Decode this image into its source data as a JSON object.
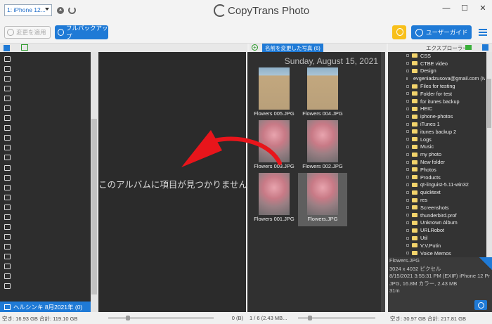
{
  "titlebar": {
    "device": "1: iPhone 12...",
    "app_title": "CopyTrans Photo",
    "minimize": "—",
    "maximize": "☐",
    "close": "✕"
  },
  "toolbar": {
    "apply_label": "変更を適用",
    "backup_label": "フルバックアップ",
    "guide_label": "ユーザーガイド"
  },
  "left": {
    "selected_album": "ヘルシンキ  8月2021年 (0)",
    "footer": "空き: 16.93 GB 合計: 119.10 GB"
  },
  "middle": {
    "empty_message": "このアルバムに項目が見つかりません。",
    "footer_right": "0 (B)"
  },
  "photos": {
    "album_tag": "名前を変更した写真 (6)",
    "date": "Sunday, August 15, 2021",
    "items": [
      {
        "name": "Flowers 005.JPG"
      },
      {
        "name": "Flowers 004.JPG"
      },
      {
        "name": "Flowers 003.JPG"
      },
      {
        "name": "Flowers 002.JPG"
      },
      {
        "name": "Flowers 001.JPG"
      },
      {
        "name": "Flowers.JPG"
      }
    ],
    "footer": "1 / 6 (2.43 MB..."
  },
  "explorer": {
    "title": "エクスプローラー",
    "items": [
      "CSS",
      "CTBE video",
      "Design",
      "evgeniadzusova@gmail.com (Iv",
      "Files for testing",
      "Folder for test",
      "for itunes backup",
      "HEIC",
      "iphone-photos",
      "iTunes 1",
      "itunes backup 2",
      "Logs",
      "Music",
      "my photo",
      "New folder",
      "Photos",
      "Products",
      "qt-linguist-5.11-win32",
      "quicktext",
      "res",
      "Screenshots",
      "thunderbird.prof",
      "Unknown Album",
      "URLRobot",
      "Util",
      "V.V.Putin",
      "Voice Memos",
      "名前を変更した写真"
    ],
    "selected_index": 27,
    "info": [
      "Flowers.JPG",
      "3024 x 4032 ピクセル",
      "8/15/2021 3:55:31 PM  (EXIF) iPhone 12 Pr",
      "JPG, 16.8M カラー, 2.43 MB",
      "31m"
    ],
    "footer": "空き: 30.97 GB 合計: 217.81 GB"
  },
  "colors": {
    "accent": "#1f7ad6",
    "arrow": "#e8151b",
    "panel_dark": "#2d2d2d"
  },
  "icons": {
    "eject": "eject-icon",
    "refresh": "refresh-icon",
    "bulb": "lightbulb-icon",
    "globe": "globe-icon",
    "menu": "hamburger-menu-icon",
    "compass": "compass-icon"
  }
}
